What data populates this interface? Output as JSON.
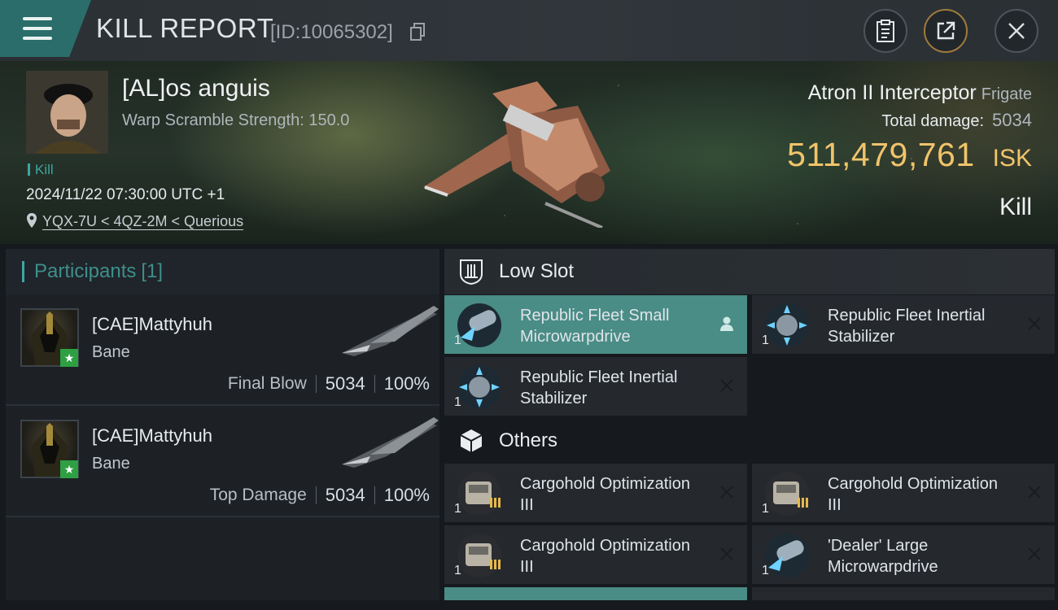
{
  "header": {
    "title": "KILL REPORT",
    "report_id": "[ID:10065302]"
  },
  "victim": {
    "pilot_name": "[AL]os anguis",
    "stat": "Warp Scramble Strength: 150.0",
    "tag": "Kill",
    "timestamp": "2024/11/22 07:30:00 UTC +1",
    "location": "YQX-7U < 4QZ-2M < Querious"
  },
  "ship": {
    "name": "Atron II Interceptor",
    "class": "Frigate",
    "total_damage_label": "Total damage:",
    "total_damage": "5034",
    "isk_value": "511,479,761",
    "isk_unit": "ISK",
    "result": "Kill"
  },
  "participants": {
    "title": "Participants",
    "count": "[1]",
    "cards": [
      {
        "name": "[CAE]Mattyhuh",
        "ship": "Bane",
        "role": "Final Blow",
        "damage": "5034",
        "percent": "100%"
      },
      {
        "name": "[CAE]Mattyhuh",
        "ship": "Bane",
        "role": "Top Damage",
        "damage": "5034",
        "percent": "100%"
      }
    ]
  },
  "slots": {
    "low_title": "Low Slot",
    "others_title": "Others",
    "low_items": [
      {
        "name": "Republic Fleet Small Microwarpdrive",
        "qty": "1"
      },
      {
        "name": "Republic Fleet Inertial Stabilizer",
        "qty": "1"
      },
      {
        "name": "Republic Fleet Inertial Stabilizer",
        "qty": "1"
      }
    ],
    "other_items": [
      {
        "name": "Cargohold Optimization III",
        "qty": "1"
      },
      {
        "name": "Cargohold Optimization III",
        "qty": "1"
      },
      {
        "name": "Cargohold Optimization III",
        "qty": "1"
      },
      {
        "name": "'Dealer' Large Microwarpdrive",
        "qty": "1"
      }
    ]
  },
  "icons": {
    "menu": "hamburger-icon",
    "copy": "copy-icon",
    "clipboard": "clipboard-icon",
    "share": "share-icon",
    "close": "close-icon",
    "location": "map-pin-icon",
    "low_slot": "low-slot-icon",
    "others": "cube-icon",
    "destroyed": "x-mark-icon",
    "dropped": "person-icon"
  },
  "colors": {
    "accent": "#3da6a0",
    "isk": "#f1c46a",
    "highlight": "#4a8c86"
  }
}
